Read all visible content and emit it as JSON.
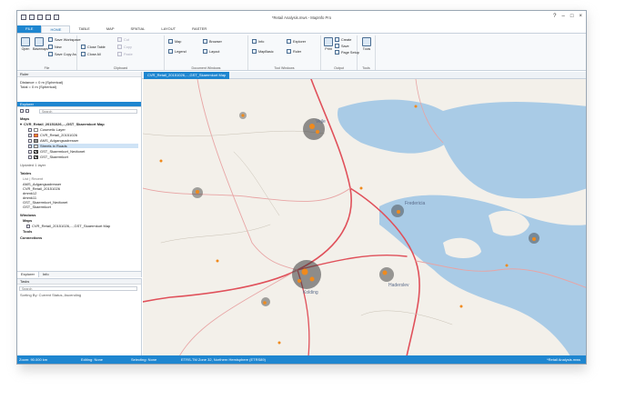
{
  "window": {
    "title": "*Retail Analysis.mws - MapInfo Pro"
  },
  "tabs": [
    "FILE",
    "HOME",
    "TABLE",
    "MAP",
    "SPATIAL",
    "LAYOUT",
    "RASTER"
  ],
  "active_tab": "HOME",
  "ribbon": {
    "file_group": {
      "open_label": "Open",
      "basemaps_label": "Basemaps",
      "save_workspace": "Save Workspace",
      "save_copy_as": "Save Copy As",
      "new_item": "New",
      "label": "File"
    },
    "clipboard_group": {
      "close_table": "Close Table",
      "close_all": "Close All",
      "cut": "Cut",
      "copy": "Copy",
      "paste": "Paste",
      "label": "Clipboard"
    },
    "document_windows": {
      "map": "Map",
      "browser": "Browser",
      "legend": "Legend",
      "layout": "Layout",
      "label": "Document Windows"
    },
    "tool_windows": {
      "info": "Info",
      "explorer": "Explorer",
      "mapbasic": "MapBasic",
      "ruler": "Ruler",
      "label": "Tool Windows"
    },
    "output": {
      "print": "Print",
      "create": "Create",
      "save": "Save",
      "page_setup": "Page Setup",
      "label": "Output"
    },
    "tools": {
      "tools": "Tools",
      "label": "Tools"
    }
  },
  "ruler": {
    "title": "Ruler",
    "distance": "Distance = 0 m (Spherical)",
    "total": "Total = 0 m (Spherical)"
  },
  "explorer": {
    "title": "Explorer",
    "search_placeholder": "Search",
    "maps_heading": "Maps",
    "map_name": "CVR_Retail_20151026,...,GST_Skaermkort Map",
    "layers": [
      "Cosmetic Layer",
      "CVR_Retail_20151026",
      "AMS_Adgangsadresser",
      "Streets in Roads",
      "GST_Skaermkort_Nedtonet",
      "GST_Skaermkort"
    ],
    "updated": "Updated 1 layer",
    "tables_heading": "Tables",
    "list_label": "List | Recent",
    "tables": [
      "AMS_Adgangsadresser",
      "CVR_Retail_20151026",
      "dmmk12",
      "dmmk11",
      "GST_Skaermkort_Nedtonet",
      "GST_Skaermkort"
    ],
    "windows_heading": "Windows",
    "windows_maps": "Maps",
    "windows_item": "CVR_Retail_20151026,...,GST_Skaermkort Map",
    "tools_heading": "Tools",
    "connections_heading": "Connections",
    "tab_explorer": "Explorer",
    "tab_info": "Info"
  },
  "tasks": {
    "title": "Tasks",
    "search_placeholder": "Search",
    "sort_label": "Sorting By: Current Status, Ascending"
  },
  "map_tab": {
    "label": "CVR_Retail_20151026,...,GST_Skaermkort Map"
  },
  "map_labels": {
    "vejle": "Vejle",
    "fredericia": "Fredericia",
    "kolding": "Kolding",
    "haderslev": "Haderslev"
  },
  "status": {
    "zoom": "Zoom: 90.000 km",
    "editing": "Editing: None",
    "selecting": "Selecting: None",
    "projection": "ETRS-TM Zone 32, Northern Hemisphere (ETRS89)",
    "workspace": "*Retail Analysis.mws"
  },
  "colors": {
    "accent": "#1e86d0",
    "water": "#a9cbe6",
    "roads": "#e0505a",
    "points": "#f08a1c"
  }
}
